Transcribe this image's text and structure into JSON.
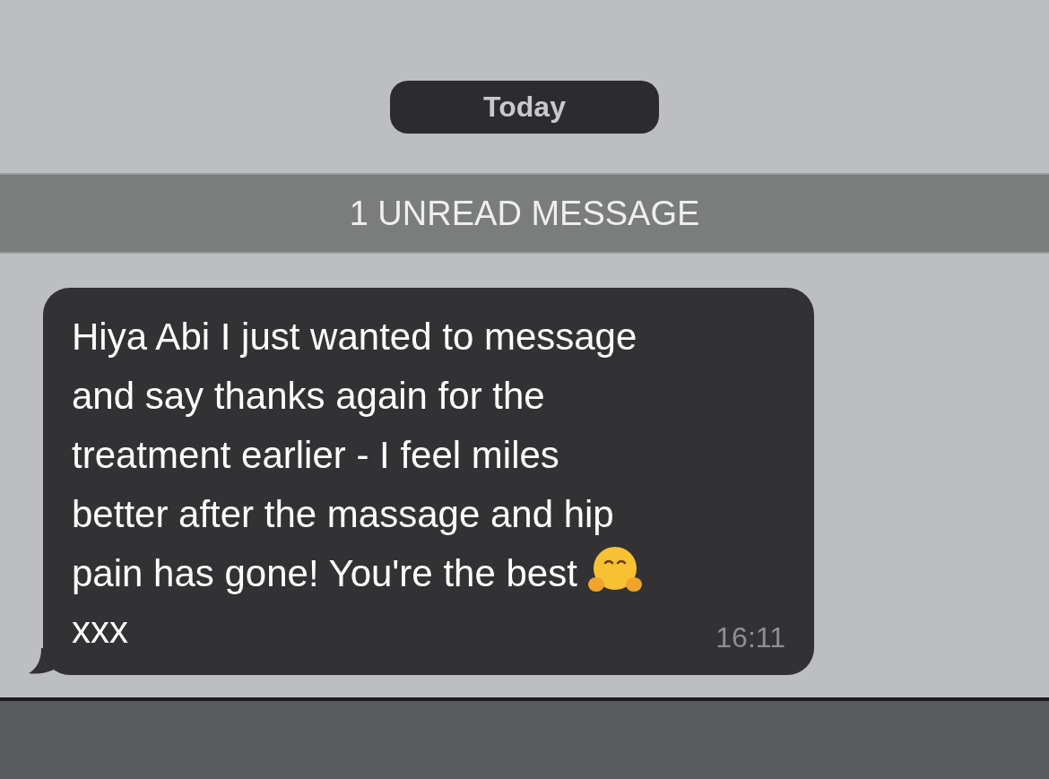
{
  "date_label": "Today",
  "unread_banner": "1 UNREAD MESSAGE",
  "messages": [
    {
      "lines": [
        "Hiya Abi I just wanted to message",
        "and say thanks again for the",
        "treatment earlier - I feel miles",
        "better after the massage and hip",
        "pain has gone! You're the best"
      ],
      "closing": "xxx",
      "time": "16:11"
    }
  ]
}
